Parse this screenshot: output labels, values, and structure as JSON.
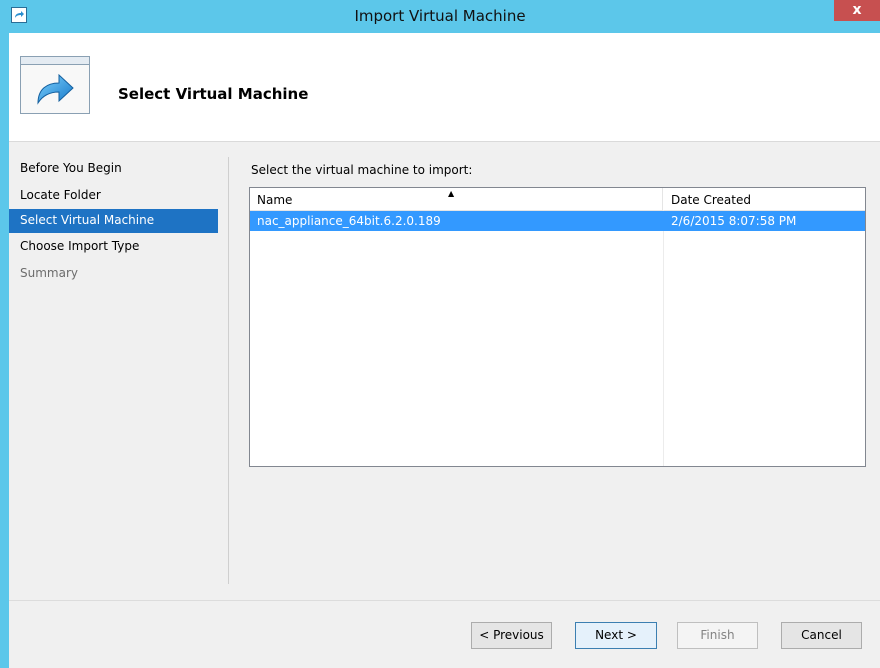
{
  "window": {
    "title": "Import Virtual Machine",
    "close_label": "x"
  },
  "header": {
    "title": "Select Virtual Machine"
  },
  "sidebar": {
    "items": [
      {
        "label": "Before You Begin",
        "state": "normal"
      },
      {
        "label": "Locate Folder",
        "state": "normal"
      },
      {
        "label": "Select Virtual Machine",
        "state": "active"
      },
      {
        "label": "Choose Import Type",
        "state": "normal"
      },
      {
        "label": "Summary",
        "state": "disabled"
      }
    ]
  },
  "main": {
    "prompt": "Select the virtual machine to import:",
    "columns": [
      "Name",
      "Date Created"
    ],
    "sorted_column": "Name",
    "rows": [
      {
        "name": "nac_appliance_64bit.6.2.0.189",
        "date_created": "2/6/2015 8:07:58 PM",
        "selected": true
      }
    ]
  },
  "buttons": {
    "previous": "< Previous",
    "next": "Next >",
    "finish": "Finish",
    "cancel": "Cancel"
  },
  "colors": {
    "title_bar": "#5cc7ea",
    "selection": "#3399ff",
    "nav_active": "#1e73c4",
    "close_button": "#c75050"
  }
}
